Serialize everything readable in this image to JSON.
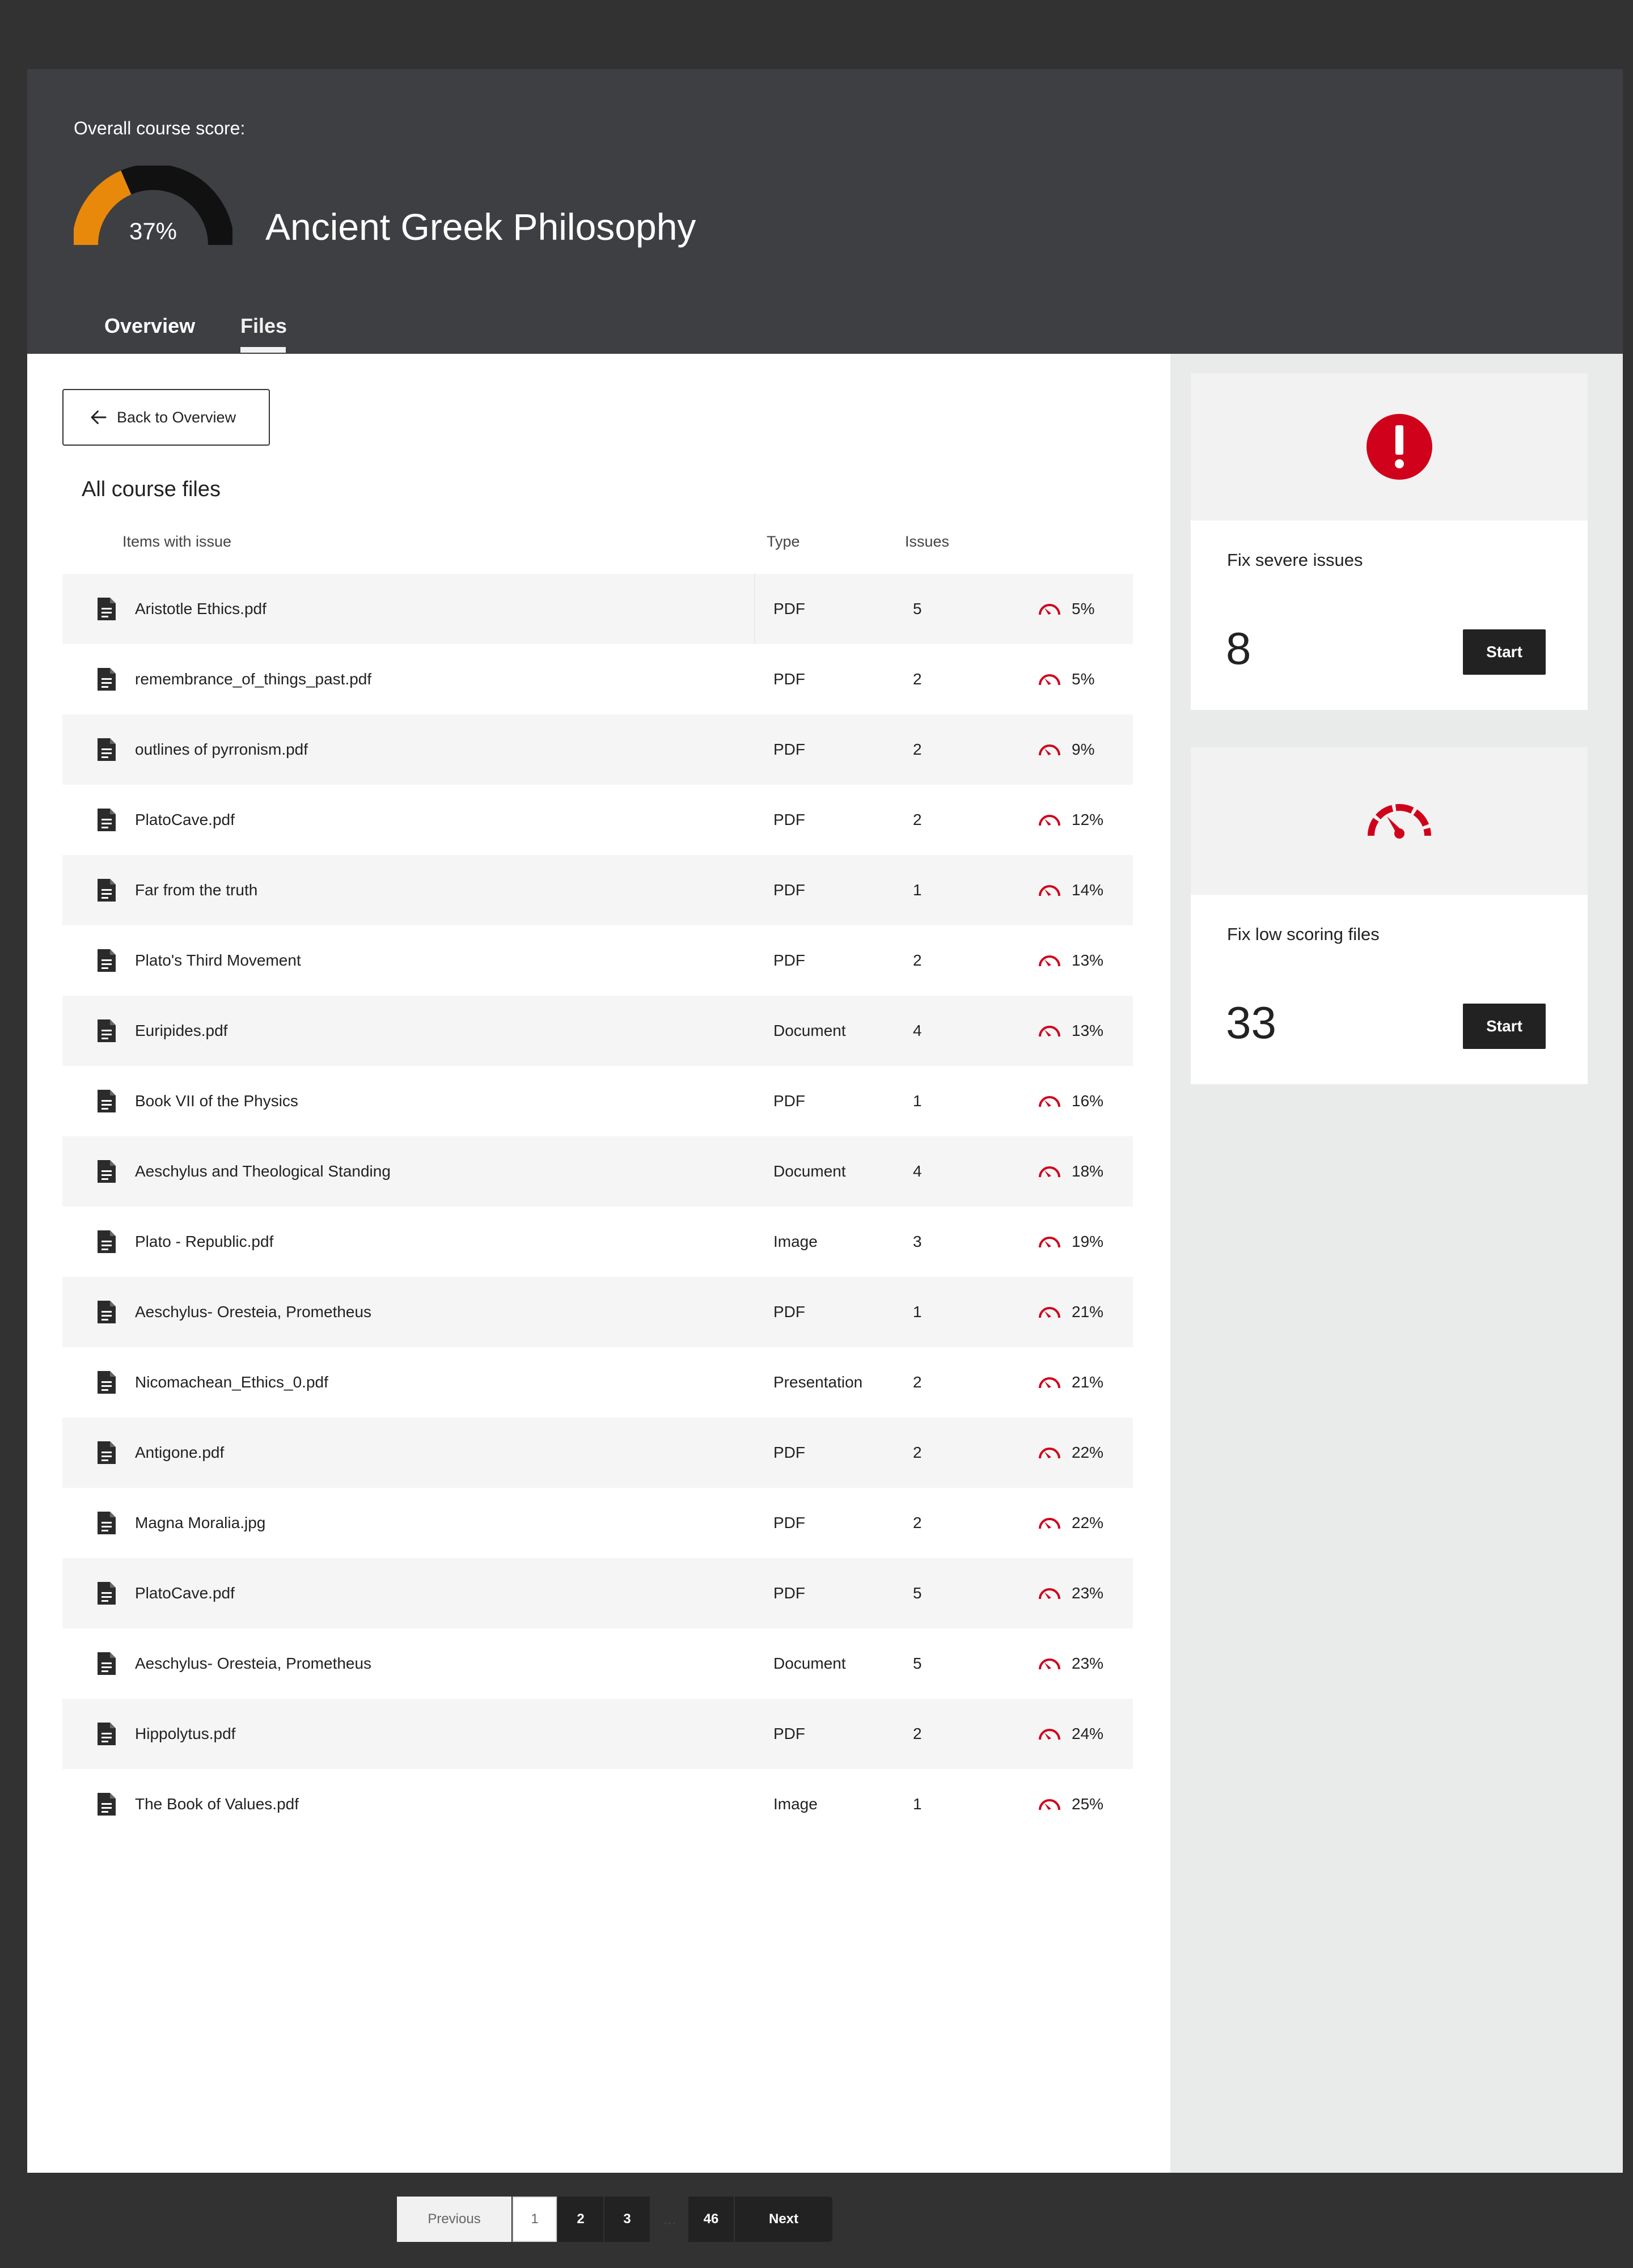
{
  "header": {
    "score_label": "Overall course score:",
    "score_percent": 37,
    "score_text": "37%",
    "course_title": "Ancient Greek Philosophy",
    "tabs": [
      "Overview",
      "Files"
    ],
    "active_tab": "Files"
  },
  "main": {
    "back_label": "Back to Overview",
    "section_title": "All course files",
    "columns": {
      "items": "Items with issue",
      "type": "Type",
      "issues": "Issues"
    },
    "rows": [
      {
        "name": "Aristotle Ethics.pdf",
        "type": "PDF",
        "issues": "5",
        "score": "5%"
      },
      {
        "name": "remembrance_of_things_past.pdf",
        "type": "PDF",
        "issues": "2",
        "score": "5%"
      },
      {
        "name": "outlines of pyrronism.pdf",
        "type": "PDF",
        "issues": "2",
        "score": "9%"
      },
      {
        "name": "PlatoCave.pdf",
        "type": "PDF",
        "issues": "2",
        "score": "12%"
      },
      {
        "name": "Far from the truth",
        "type": "PDF",
        "issues": "1",
        "score": "14%"
      },
      {
        "name": "Plato's Third Movement",
        "type": "PDF",
        "issues": "2",
        "score": "13%"
      },
      {
        "name": "Euripides.pdf",
        "type": "Document",
        "issues": "4",
        "score": "13%"
      },
      {
        "name": "Book VII of the Physics",
        "type": "PDF",
        "issues": "1",
        "score": "16%"
      },
      {
        "name": "Aeschylus and Theological Standing",
        "type": "Document",
        "issues": "4",
        "score": "18%"
      },
      {
        "name": "Plato - Republic.pdf",
        "type": "Image",
        "issues": "3",
        "score": "19%"
      },
      {
        "name": "Aeschylus- Oresteia, Prometheus",
        "type": "PDF",
        "issues": "1",
        "score": "21%"
      },
      {
        "name": "Nicomachean_Ethics_0.pdf",
        "type": "Presentation",
        "issues": "2",
        "score": "21%"
      },
      {
        "name": "Antigone.pdf",
        "type": "PDF",
        "issues": "2",
        "score": "22%"
      },
      {
        "name": "Magna Moralia.jpg",
        "type": "PDF",
        "issues": "2",
        "score": "22%"
      },
      {
        "name": "PlatoCave.pdf",
        "type": "PDF",
        "issues": "5",
        "score": "23%"
      },
      {
        "name": "Aeschylus- Oresteia, Prometheus",
        "type": "Document",
        "issues": "5",
        "score": "23%"
      },
      {
        "name": "Hippolytus.pdf",
        "type": "PDF",
        "issues": "2",
        "score": "24%"
      },
      {
        "name": "The Book of Values.pdf",
        "type": "Image",
        "issues": "1",
        "score": "25%"
      }
    ],
    "pagination": {
      "previous": "Previous",
      "pages": [
        "1",
        "2",
        "3"
      ],
      "ellipsis": "...",
      "last": "46",
      "next": "Next"
    }
  },
  "side": {
    "severe": {
      "label": "Fix severe issues",
      "count": "8",
      "button": "Start"
    },
    "low": {
      "label": "Fix low scoring files",
      "count": "33",
      "button": "Start"
    }
  },
  "colors": {
    "accent_red": "#d0021b",
    "gauge_orange": "#e8890c",
    "dark": "#222222"
  }
}
